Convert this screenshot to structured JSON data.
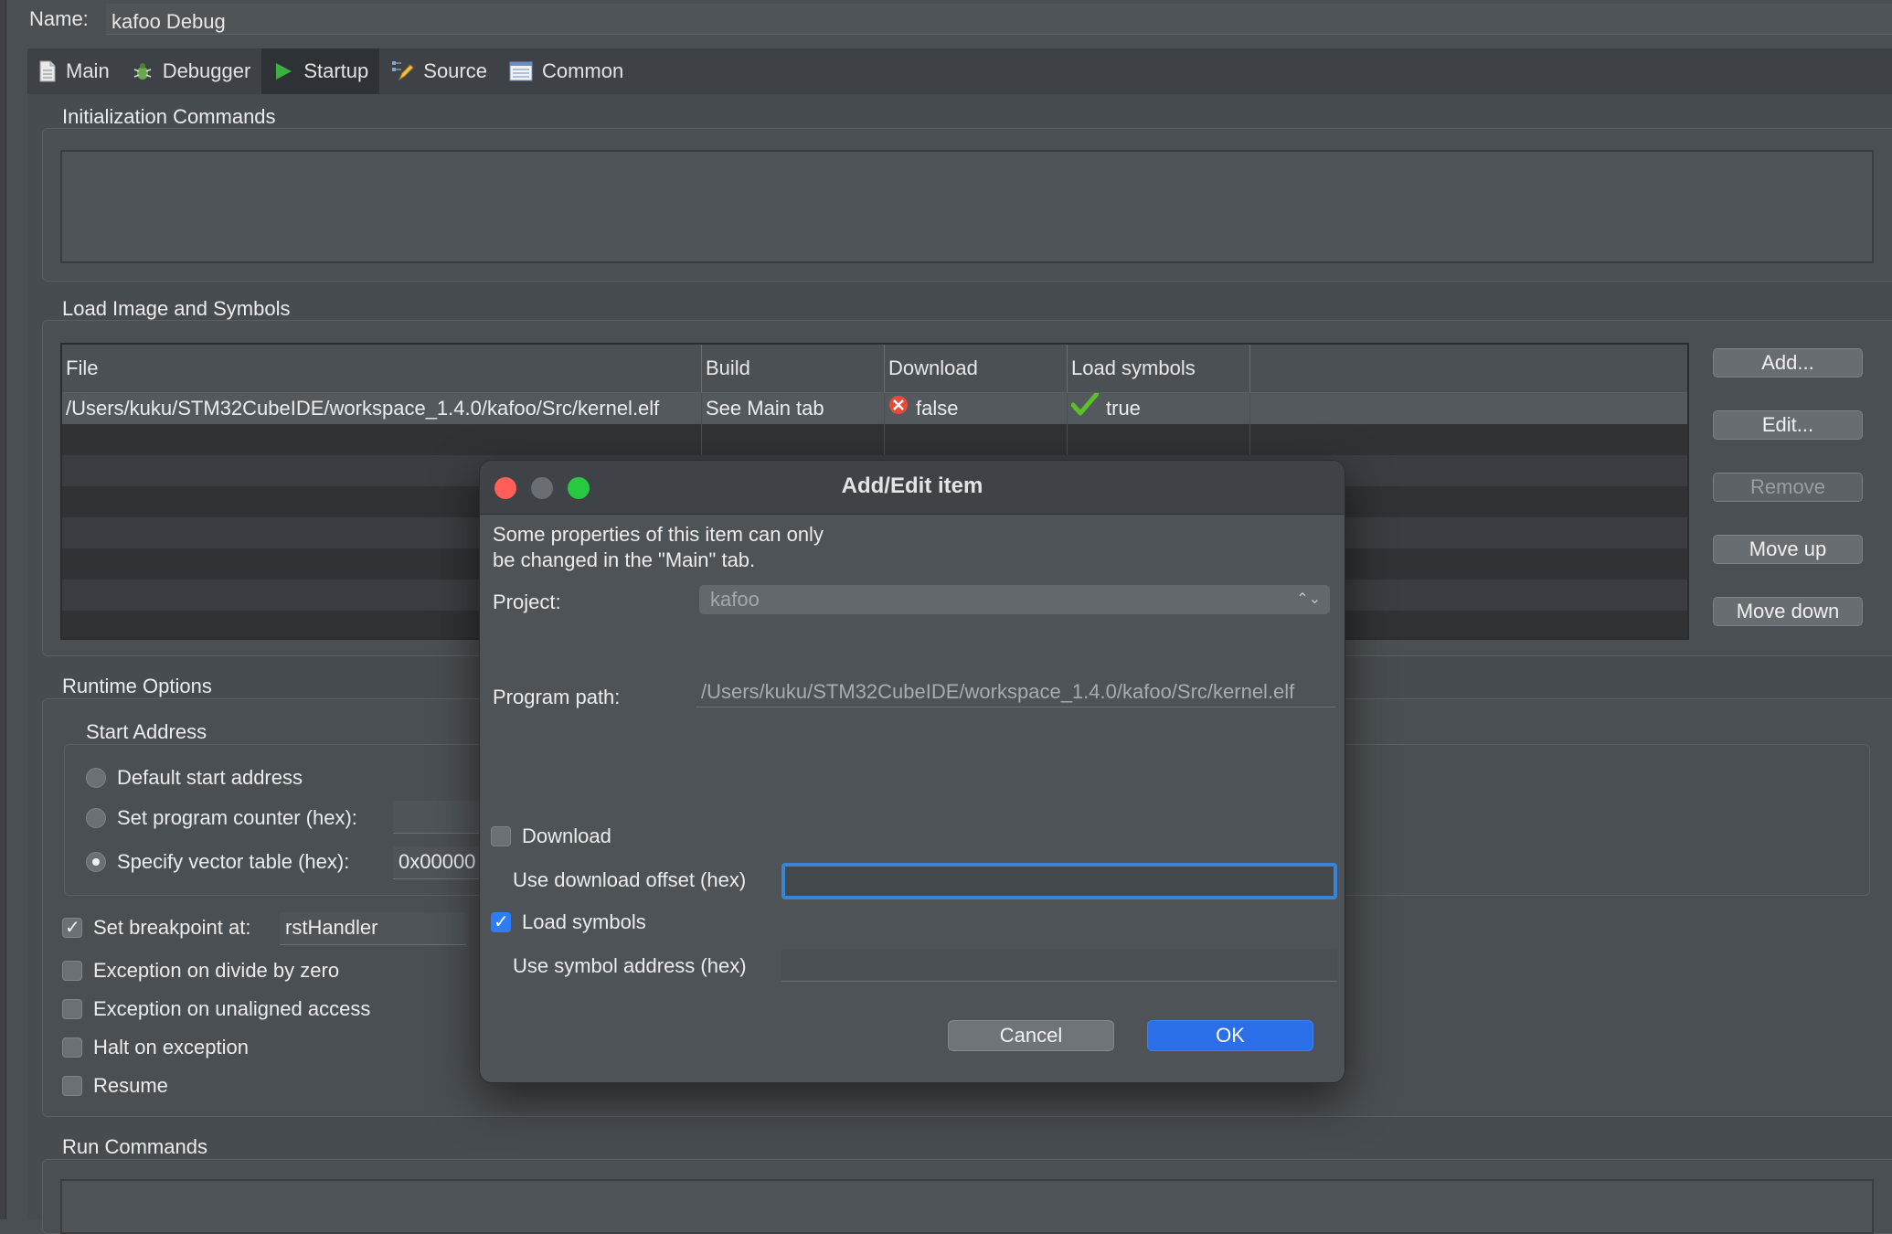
{
  "name_row": {
    "label": "Name:",
    "value": "kafoo Debug"
  },
  "tabs": [
    {
      "label": "Main",
      "icon": "document-icon"
    },
    {
      "label": "Debugger",
      "icon": "bug-icon"
    },
    {
      "label": "Startup",
      "icon": "play-icon",
      "active": true
    },
    {
      "label": "Source",
      "icon": "source-icon"
    },
    {
      "label": "Common",
      "icon": "list-icon"
    }
  ],
  "init_commands": {
    "title": "Initialization Commands"
  },
  "load_image": {
    "title": "Load Image and Symbols",
    "columns": [
      "File",
      "Build",
      "Download",
      "Load symbols"
    ],
    "rows": [
      {
        "file": "/Users/kuku/STM32CubeIDE/workspace_1.4.0/kafoo/Src/kernel.elf",
        "build": "See Main tab",
        "download": "false",
        "load_symbols": "true"
      }
    ],
    "buttons": {
      "add": "Add...",
      "edit": "Edit...",
      "remove": "Remove",
      "move_up": "Move up",
      "move_down": "Move down"
    }
  },
  "runtime": {
    "title": "Runtime Options",
    "start_address": {
      "title": "Start Address",
      "default": "Default start address",
      "set_pc": "Set program counter (hex):",
      "vector_table": "Specify vector table (hex):",
      "vector_value": "0x00000"
    },
    "breakpoint": {
      "label": "Set breakpoint at:",
      "value": "rstHandler"
    },
    "options": {
      "div_zero": "Exception on divide by zero",
      "unaligned": "Exception on unaligned access",
      "halt": "Halt on exception",
      "resume": "Resume"
    }
  },
  "run_commands": {
    "title": "Run Commands"
  },
  "dialog": {
    "title": "Add/Edit item",
    "info_line1": "Some properties of this item can only",
    "info_line2": "be changed in the \"Main\" tab.",
    "project_label": "Project:",
    "project_value": "kafoo",
    "program_path_label": "Program path:",
    "program_path_value": "/Users/kuku/STM32CubeIDE/workspace_1.4.0/kafoo/Src/kernel.elf",
    "download_label": "Download",
    "download_offset_label": "Use download offset (hex)",
    "load_symbols_label": "Load symbols",
    "symbol_address_label": "Use symbol address (hex)",
    "cancel": "Cancel",
    "ok": "OK"
  },
  "colors": {
    "accent": "#2a6fe8",
    "focus": "#3a84d6",
    "close": "#ff5f57",
    "zoom": "#28c840"
  }
}
